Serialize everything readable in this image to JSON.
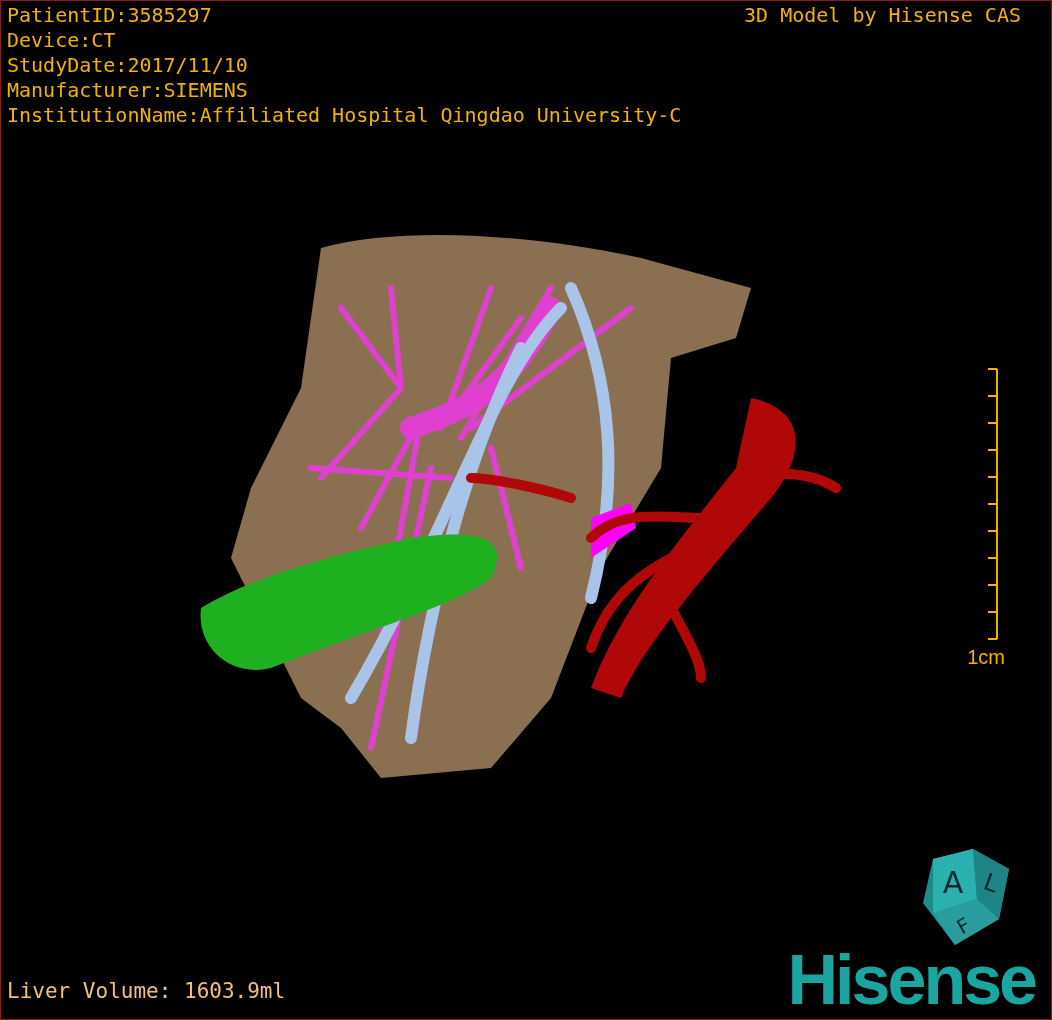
{
  "header": {
    "info_lines": [
      "PatientID:3585297",
      "Device:CT",
      "StudyDate:2017/11/10",
      "Manufacturer:SIEMENS",
      "InstitutionName:Affiliated Hospital Qingdao University-C"
    ],
    "credit": "3D Model by Hisense CAS"
  },
  "scale_bar": {
    "label": "1cm"
  },
  "orientation_cube": {
    "faces": [
      "A",
      "F",
      "L"
    ]
  },
  "footer": {
    "measurement": "Liver Volume: 1603.9ml",
    "logo": "Hisense"
  }
}
